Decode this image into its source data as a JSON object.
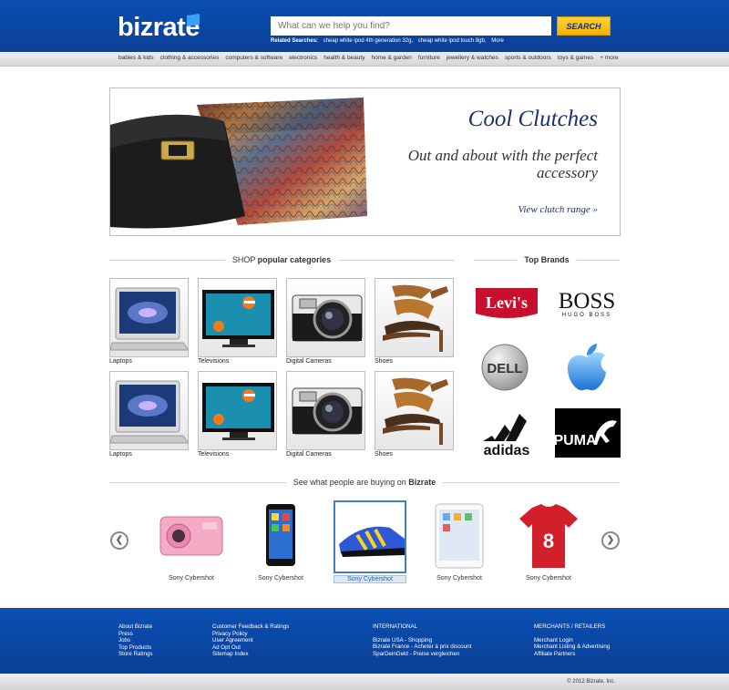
{
  "header": {
    "logo": "bizrate",
    "search_placeholder": "What can we help you find?",
    "search_button": "SEARCH",
    "related_label": "Related Searches:",
    "related": [
      "cheap white ipod 4th generation 32g,",
      "cheap white ipod touch 8gb,",
      "More"
    ]
  },
  "categories_nav": [
    "babies & kids",
    "clothing & accessories",
    "computers & software",
    "electronics",
    "health & beauty",
    "home & garden",
    "furniture",
    "jewellery & watches",
    "sports & outdoors",
    "toys & games",
    "+ more"
  ],
  "hero": {
    "title": "Cool Clutches",
    "subtitle": "Out and about with the perfect accessory",
    "link": "View clutch range »"
  },
  "shop_section": {
    "prefix": "SHOP",
    "bold": "popular categories"
  },
  "tiles": [
    {
      "label": "Laptops",
      "icon": "laptop-icon"
    },
    {
      "label": "Televisions",
      "icon": "television-icon"
    },
    {
      "label": "Digital Cameras",
      "icon": "camera-icon"
    },
    {
      "label": "Shoes",
      "icon": "shoe-icon"
    },
    {
      "label": "Laptops",
      "icon": "laptop-icon"
    },
    {
      "label": "Televisions",
      "icon": "television-icon"
    },
    {
      "label": "Digital Cameras",
      "icon": "camera-icon"
    },
    {
      "label": "Shoes",
      "icon": "shoe-icon"
    }
  ],
  "brands_section": {
    "title": "Top Brands"
  },
  "brands": {
    "levis": "Levi's",
    "boss": "BOSS",
    "boss_sub": "HUGO BOSS",
    "dell": "DELL",
    "apple": "apple-logo-icon",
    "adidas": "adidas",
    "puma": "PUMA"
  },
  "buying_section": {
    "prefix": "See what people are buying on",
    "bold": "Bizrate"
  },
  "products": [
    {
      "label": "Sony Cybershot",
      "icon": "pink-camera-icon",
      "selected": false
    },
    {
      "label": "Sony Cybershot",
      "icon": "smartphone-icon",
      "selected": false
    },
    {
      "label": "Sony Cybershot",
      "icon": "sneaker-icon",
      "selected": true
    },
    {
      "label": "Sony Cybershot",
      "icon": "tablet-icon",
      "selected": false
    },
    {
      "label": "Sony Cybershot",
      "icon": "football-shirt-icon",
      "selected": false
    }
  ],
  "footer": {
    "col1": [
      "About Bizrate",
      "Press",
      "Jobs",
      "Top Products",
      "Store Ratings"
    ],
    "col2": [
      "Customer Feedback & Ratings",
      "Privacy Policy",
      "User Agreement",
      "Ad Opt Out",
      "Sitemap Index"
    ],
    "col3_head": "INTERNATIONAL",
    "col3": [
      "Bizrate USA - Shopping",
      "Bizrate France - Acheter à prix discount",
      "SparDeinGeld - Preise vergleichen"
    ],
    "col4_head": "MERCHANTS / RETAILERS",
    "col4": [
      "Merchant Login",
      "Merchant Listing & Advertising",
      "Affiliate Partners"
    ],
    "copyright": "© 2012 Bizrate, Inc."
  },
  "colors": {
    "brand_blue": "#0b4aa8",
    "search_yellow": "#f4b400",
    "headline_navy": "#1b2f6e"
  }
}
